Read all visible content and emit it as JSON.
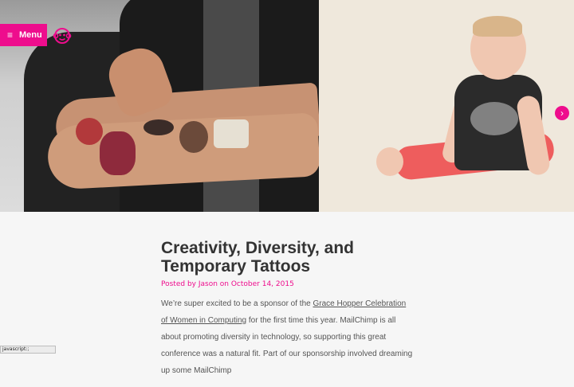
{
  "nav": {
    "menu_label": "Menu",
    "menu_icon": "hamburger-icon",
    "logo_icon": "monkey-logo-icon"
  },
  "slider": {
    "next_icon": "chevron-right-icon",
    "next_glyph": "›"
  },
  "article": {
    "title": "Creativity, Diversity, and Temporary Tattoos",
    "meta": "Posted by Jason on October 14, 2015",
    "body_before_link": "We’re super excited to be a sponsor of the ",
    "link_text": "Grace Hopper Celebration of Women in Computing",
    "body_after_link": " for the first time this year. MailChimp is all about promoting diversity in technology, so supporting this great conference was a natural fit. Part of our sponsorship involved dreaming up some MailChimp"
  },
  "status_bar": {
    "text": "javascript:;"
  },
  "colors": {
    "accent": "#ee0d8d",
    "text": "#333333",
    "background": "#f6f6f6"
  }
}
